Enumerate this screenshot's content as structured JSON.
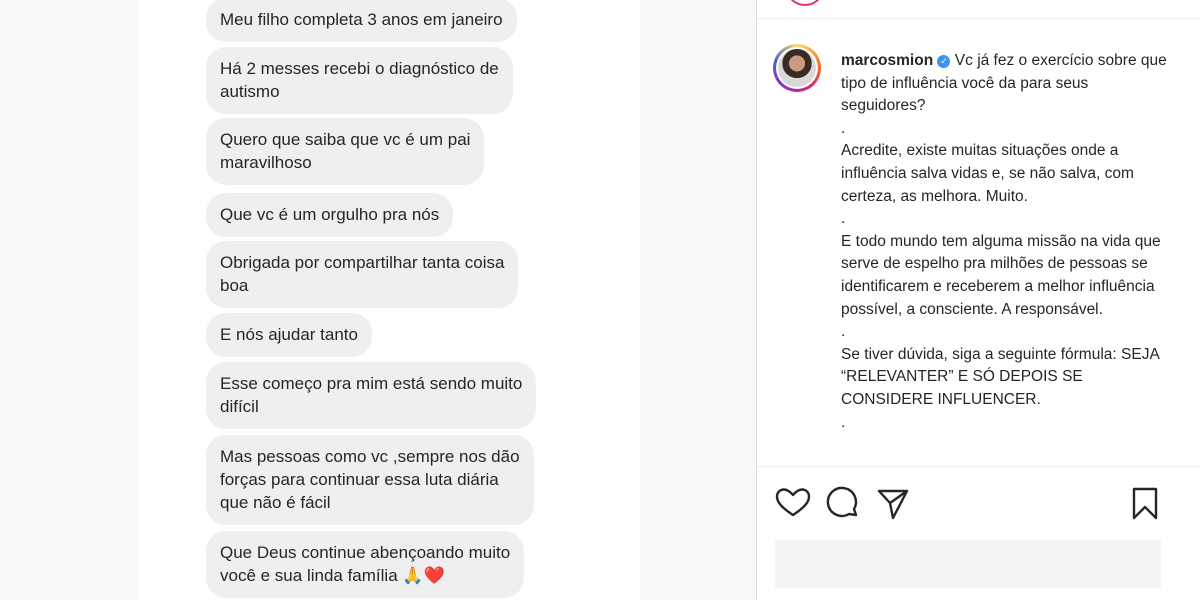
{
  "chat_messages": [
    "Meu filho completa 3 anos em janeiro",
    "Há 2 messes recebi o diagnóstico de\nautismo",
    "Quero que saiba que vc é um pai\nmaravilhoso",
    "Que vc é um orgulho pra nós",
    "Obrigada por compartilhar tanta coisa\nboa",
    "E nós ajudar tanto",
    "Esse começo pra mim está sendo muito\ndifícil",
    "Mas pessoas como vc ,sempre nos dão\nforças para continuar essa luta diária\nque não é fácil",
    "Que Deus continue abençoando muito\nvocê e sua linda família 🙏❤️"
  ],
  "post": {
    "username": "marcosmion",
    "verified_icon": "verified-badge-icon",
    "caption_lines": [
      "Vc já fez o exercício sobre que tipo de influência você da para seus seguidores?",
      ".",
      "Acredite, existe muitas situações onde a influência salva vidas e, se não salva, com certeza, as melhora. Muito.",
      ".",
      "E todo mundo tem alguma missão na vida que serve de espelho pra milhões de pessoas se identificarem e receberem a melhor influência possível, a consciente. A responsável.",
      ".",
      "Se tiver dúvida, siga a seguinte fórmula: SEJA “RELEVANTER” E SÓ DEPOIS SE CONSIDERE INFLUENCER.",
      "."
    ]
  },
  "actions": {
    "like_icon": "heart-icon",
    "comment_icon": "comment-icon",
    "share_icon": "share-icon",
    "save_icon": "bookmark-icon"
  },
  "colors": {
    "bubble_bg": "#efefef",
    "text": "#262626",
    "verified": "#3897f0",
    "border": "#dbdbdb"
  }
}
